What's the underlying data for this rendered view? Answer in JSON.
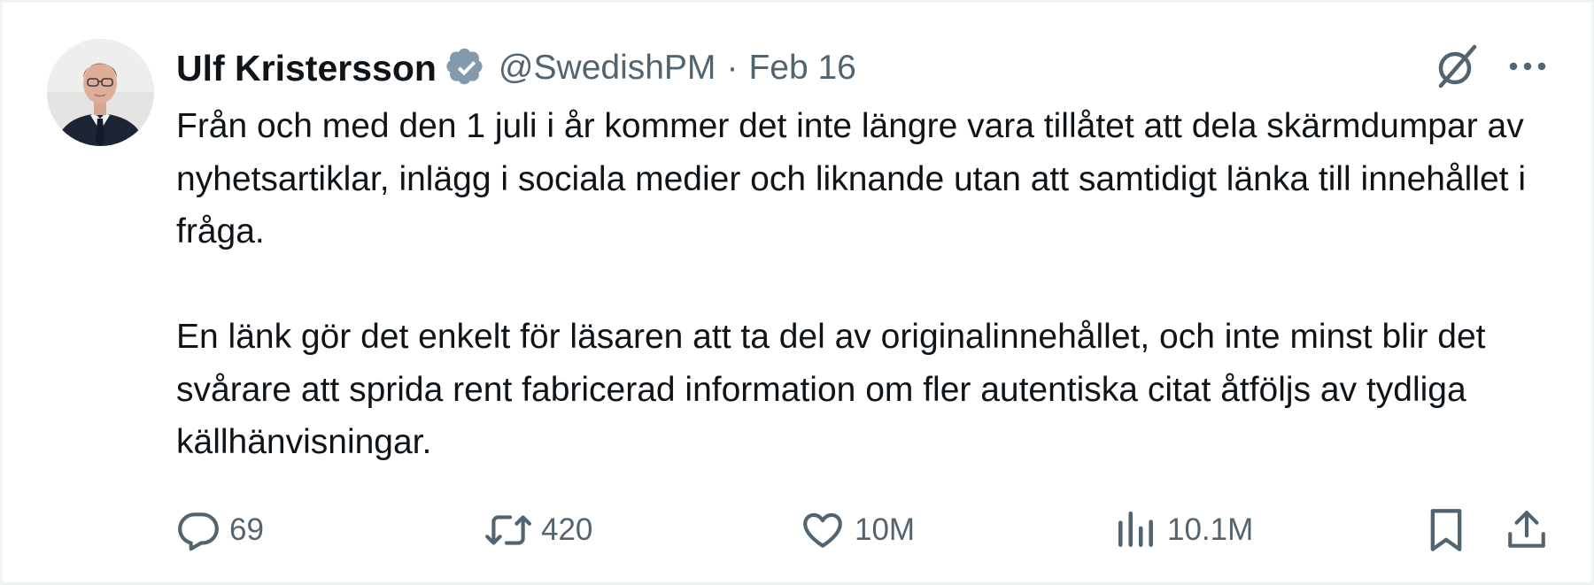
{
  "post": {
    "author_name": "Ulf Kristersson",
    "handle": "@SwedishPM",
    "separator": "·",
    "date": "Feb 16",
    "text": "Från och med den 1 juli i år kommer det inte längre vara tillåtet att dela skärmdumpar av nyhetsartiklar, inlägg i sociala medier och liknande utan att samtidigt länka till innehållet i fråga.\n\nEn länk gör det enkelt för läsaren att ta del av originalinnehållet, och inte minst blir det svårare att sprida rent fabricerad information om fler autentiska citat åtföljs av tydliga källhänvisningar.",
    "verified_badge_color": "#829aab"
  },
  "actions": {
    "replies": "69",
    "reposts": "420",
    "likes": "10M",
    "views": "10.1M"
  },
  "icons": {
    "avatar": "portrait-photo",
    "verified": "verified-badge-icon",
    "grok": "grok-icon",
    "more": "more-icon",
    "reply": "reply-icon",
    "repost": "repost-icon",
    "like": "like-icon",
    "views": "views-icon",
    "bookmark": "bookmark-icon",
    "share": "share-icon"
  },
  "colors": {
    "text_primary": "#0f1419",
    "text_secondary": "#536471",
    "border": "#eff3f4"
  }
}
